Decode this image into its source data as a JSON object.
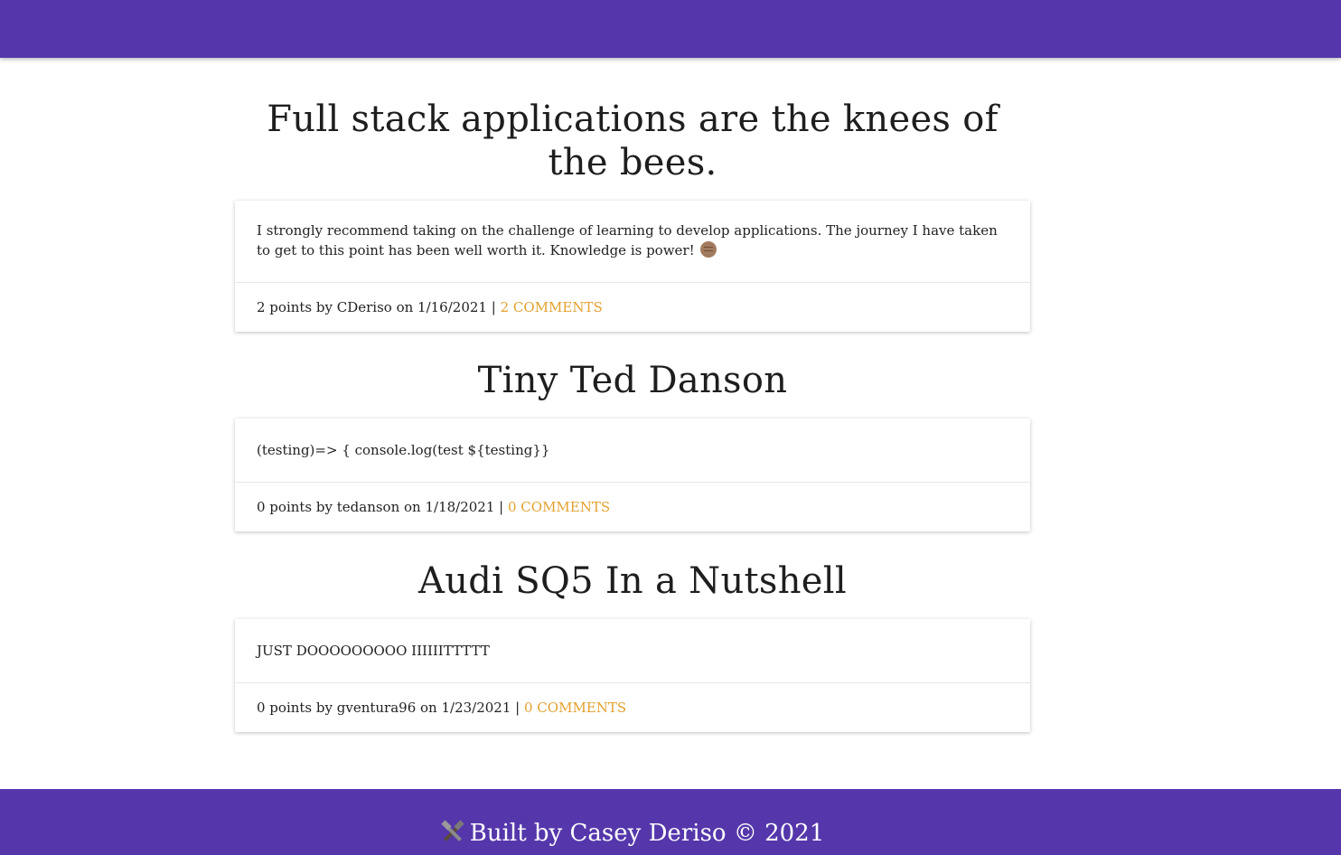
{
  "colors": {
    "brand": "#5537ab",
    "link": "#e3a12f"
  },
  "posts": [
    {
      "title": "Full stack applications are the knees of the bees.",
      "body": "I strongly recommend taking on the challenge of learning to develop applications. The journey I have taken to get to this point has been well worth it. Knowledge is power!",
      "body_icon": "raised-fist-icon",
      "meta": "2 points by CDeriso on 1/16/2021 |",
      "comments": "2 COMMENTS"
    },
    {
      "title": "Tiny Ted Danson",
      "body": "(testing)=> { console.log(test ${testing}}",
      "meta": "0 points by tedanson on 1/18/2021 |",
      "comments": "0 COMMENTS"
    },
    {
      "title": "Audi SQ5 In a Nutshell",
      "body": "JUST DOOOOOOOOO IIIIIITTTTT",
      "meta": "0 points by gventura96 on 1/23/2021 |",
      "comments": "0 COMMENTS"
    }
  ],
  "footer": {
    "icon": "hammer-and-wrench-icon",
    "text": "Built by Casey Deriso © 2021"
  }
}
